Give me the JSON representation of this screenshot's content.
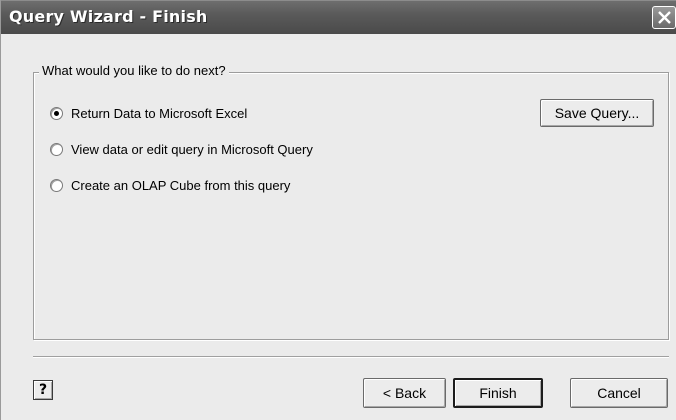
{
  "window": {
    "title": "Query Wizard - Finish"
  },
  "group": {
    "legend": "What would you like to do next?",
    "options": [
      {
        "label": "Return Data to Microsoft Excel",
        "selected": true
      },
      {
        "label": "View data or edit query in Microsoft Query",
        "selected": false
      },
      {
        "label": "Create an OLAP Cube from this query",
        "selected": false
      }
    ],
    "save_query_label": "Save Query..."
  },
  "footer": {
    "help_glyph": "?",
    "back_label": "< Back",
    "finish_label": "Finish",
    "cancel_label": "Cancel"
  },
  "icons": {
    "close": "close-icon",
    "help": "help-icon"
  }
}
